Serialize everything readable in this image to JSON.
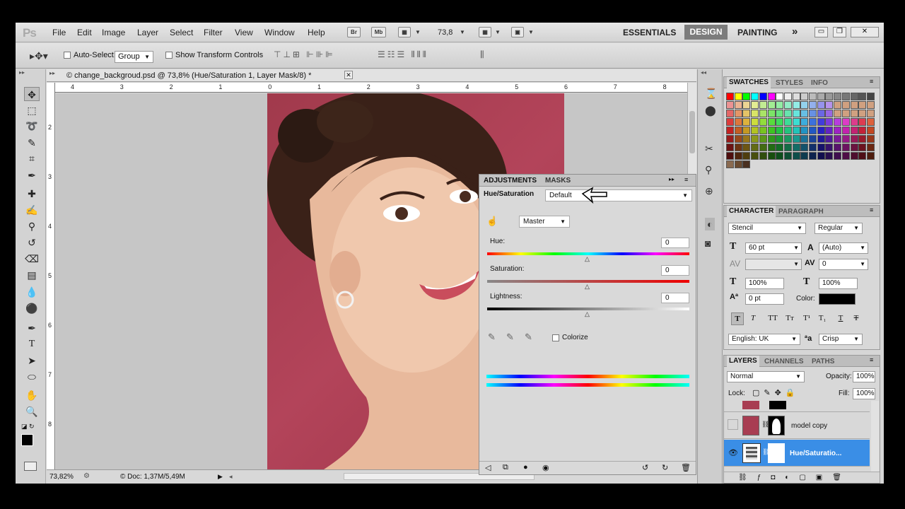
{
  "menubar": {
    "logo": "Ps",
    "items": [
      "File",
      "Edit",
      "Image",
      "Layer",
      "Select",
      "Filter",
      "View",
      "Window",
      "Help"
    ],
    "bridge": "Br",
    "minibridge": "Mb",
    "zoom": "73,8",
    "workspaces": [
      "ESSENTIALS",
      "DESIGN",
      "PAINTING"
    ],
    "more": "»",
    "active_workspace": "DESIGN"
  },
  "options": {
    "autoselect_label": "Auto-Select:",
    "autoselect_value": "Group",
    "transform_label": "Show Transform Controls"
  },
  "document": {
    "tab_title": "© change_backgroud.psd @ 73,8% (Hue/Saturation 1, Layer Mask/8) *",
    "ruler_h": [
      "4",
      "3",
      "2",
      "1",
      "0",
      "1",
      "2",
      "3",
      "4",
      "5",
      "6",
      "7",
      "8"
    ],
    "ruler_v": [
      "2",
      "3",
      "4",
      "5",
      "6",
      "7",
      "8"
    ],
    "zoom_status": "73,82%",
    "doc_status": "© Doc: 1,37M/5,49M"
  },
  "adjustments": {
    "tabs": [
      "ADJUSTMENTS",
      "MASKS"
    ],
    "title": "Hue/Saturation",
    "preset": "Default",
    "channel": "Master",
    "hue_label": "Hue:",
    "hue_value": "0",
    "sat_label": "Saturation:",
    "sat_value": "0",
    "light_label": "Lightness:",
    "light_value": "0",
    "colorize_label": "Colorize"
  },
  "swatches": {
    "tabs": [
      "SWATCHES",
      "STYLES",
      "INFO"
    ]
  },
  "character": {
    "tabs": [
      "CHARACTER",
      "PARAGRAPH"
    ],
    "font": "Stencil",
    "style": "Regular",
    "size": "60 pt",
    "leading": "(Auto)",
    "tracking": "0",
    "vscale": "100%",
    "hscale": "100%",
    "baseline": "0 pt",
    "color_label": "Color:",
    "language": "English: UK",
    "aa_label": "ªa",
    "antialias": "Crisp"
  },
  "layers": {
    "tabs": [
      "LAYERS",
      "CHANNELS",
      "PATHS"
    ],
    "blend": "Normal",
    "opacity_label": "Opacity:",
    "opacity": "100%",
    "lock_label": "Lock:",
    "fill_label": "Fill:",
    "fill": "100%",
    "rows": [
      {
        "name": "model copy"
      },
      {
        "name": "Hue/Saturatio..."
      }
    ]
  },
  "colors": {
    "selected_layer": "#3a8ee6",
    "photo_bg": "#a83d52"
  }
}
